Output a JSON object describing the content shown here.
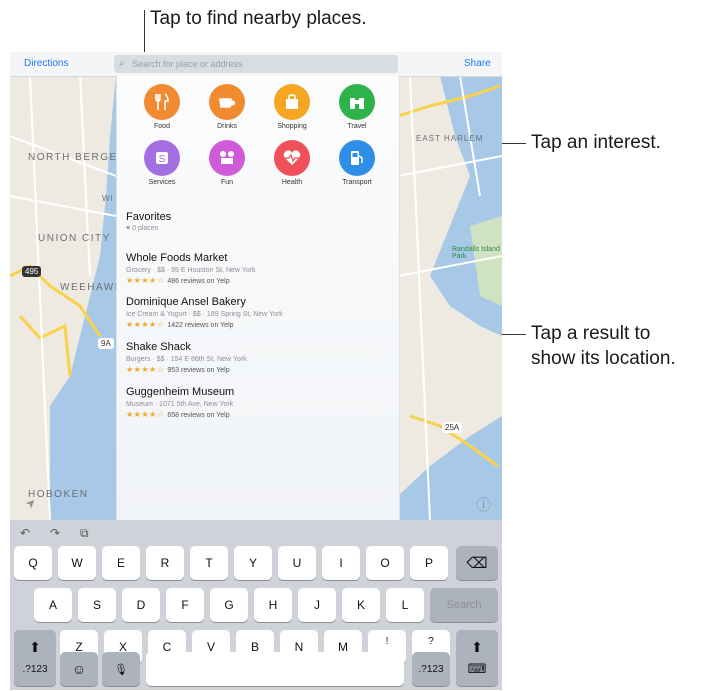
{
  "callouts": {
    "top": "Tap to find nearby places.",
    "interest": "Tap an interest.",
    "result_line1": "Tap a result to",
    "result_line2": "show its location."
  },
  "navbar": {
    "directions": "Directions",
    "search_placeholder": "Search for place or address",
    "share": "Share"
  },
  "map_labels": {
    "north_bergen": "NORTH BERGEN",
    "union_city": "UNION CITY",
    "weehawken": "WEEHAWK",
    "hoboken": "HOBOKEN",
    "wi": "WI",
    "east_harlem": "EAST HARLEM",
    "randalls_island": "Randalls Island Park",
    "route_495": "495",
    "route_9a": "9A",
    "route_25a": "25A"
  },
  "categories": [
    {
      "label": "Food",
      "color": "#f28a30",
      "icon": "fork-knife-icon"
    },
    {
      "label": "Drinks",
      "color": "#f28a30",
      "icon": "coffee-cup-icon"
    },
    {
      "label": "Shopping",
      "color": "#f5a623",
      "icon": "shopping-bag-icon"
    },
    {
      "label": "Travel",
      "color": "#2db34a",
      "icon": "binoculars-icon"
    },
    {
      "label": "Services",
      "color": "#a46ee0",
      "icon": "services-icon"
    },
    {
      "label": "Fun",
      "color": "#d05bd8",
      "icon": "fun-icon"
    },
    {
      "label": "Health",
      "color": "#f0505a",
      "icon": "heart-pulse-icon"
    },
    {
      "label": "Transport",
      "color": "#2f8ee8",
      "icon": "gas-pump-icon"
    }
  ],
  "favorites": {
    "title": "Favorites",
    "count": "♥ 0 places"
  },
  "results": [
    {
      "name": "Whole Foods Market",
      "details": "Grocery · $$ · 95 E Houston St, New York",
      "stars": "★★★★☆",
      "reviews": "486 reviews on Yelp"
    },
    {
      "name": "Dominique Ansel Bakery",
      "details": "Ice Cream & Yogurt · $$ · 189 Spring St, New York",
      "stars": "★★★★☆",
      "reviews": "1422 reviews on Yelp"
    },
    {
      "name": "Shake Shack",
      "details": "Burgers · $$ · 154 E 86th St, New York",
      "stars": "★★★★☆",
      "reviews": "953 reviews on Yelp"
    },
    {
      "name": "Guggenheim Museum",
      "details": "Museum · 1071 5th Ave, New York",
      "stars": "★★★★☆",
      "reviews": "658 reviews on Yelp"
    }
  ],
  "keyboard": {
    "row1": [
      "Q",
      "W",
      "E",
      "R",
      "T",
      "Y",
      "U",
      "I",
      "O",
      "P"
    ],
    "row2": [
      "A",
      "S",
      "D",
      "F",
      "G",
      "H",
      "J",
      "K",
      "L"
    ],
    "row3": [
      "Z",
      "X",
      "C",
      "V",
      "B",
      "N",
      "M",
      "!\n,",
      "?\n."
    ],
    "search": "Search",
    "numbers": ".?123",
    "backspace": "⌫",
    "shift": "⬆",
    "emoji": "☺",
    "mic": "🎙",
    "hide": "⌨"
  },
  "toolbar": {
    "undo": "↶",
    "redo": "↷",
    "paste": "⧉"
  },
  "map_controls": {
    "location": "➤",
    "info": "ⓘ"
  }
}
